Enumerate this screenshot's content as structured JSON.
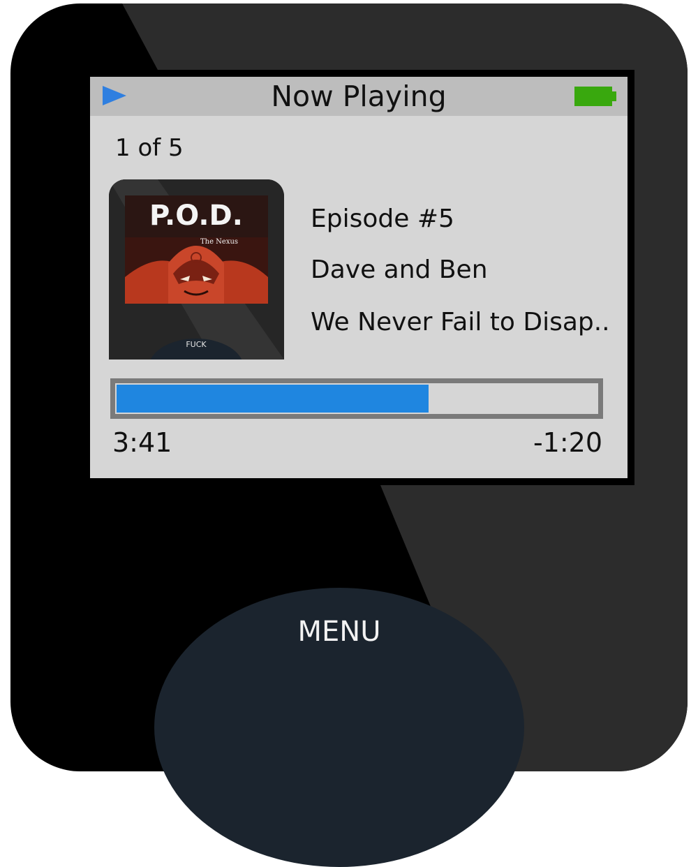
{
  "status_bar": {
    "title": "Now Playing",
    "play_icon": "play-icon",
    "battery_icon": "battery-icon"
  },
  "track": {
    "counter": "1 of 5",
    "episode": "Episode #5",
    "artist": "Dave and Ben",
    "album": "We Never Fail to Disap.."
  },
  "album_art": {
    "band": "P.O.D.",
    "subtitle": "The Nexus",
    "caption": "FUCK"
  },
  "progress": {
    "elapsed": "3:41",
    "remaining": "-1:20",
    "fraction": 0.65
  },
  "controls": {
    "menu_label": "MENU"
  },
  "colors": {
    "accent": "#1f86e0",
    "battery": "#39a80e",
    "screen_bg": "#d6d6d6",
    "status_bar_bg": "#bdbdbd",
    "wheel": "#1b242e"
  }
}
